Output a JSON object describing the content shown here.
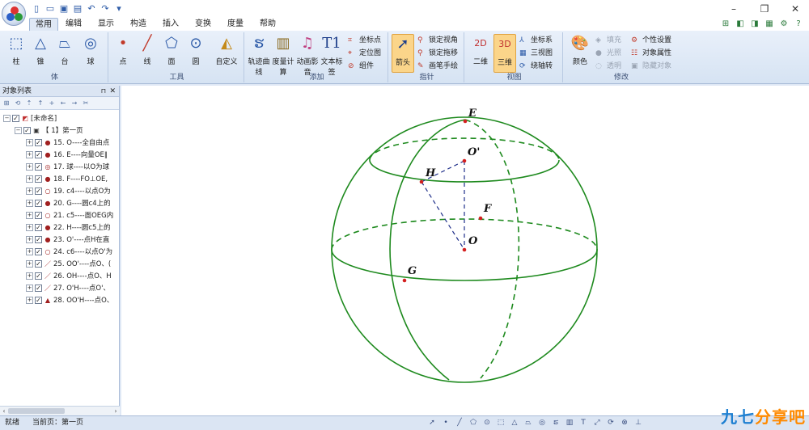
{
  "qat": {
    "icons": [
      "new-file-icon",
      "open-folder-icon",
      "save-icon",
      "print-icon",
      "undo-icon",
      "redo-icon"
    ]
  },
  "window": {
    "minimize": "–",
    "restore": "❐",
    "close": "✕"
  },
  "tabs": [
    {
      "label": "常用"
    },
    {
      "label": "编辑"
    },
    {
      "label": "显示"
    },
    {
      "label": "构造"
    },
    {
      "label": "插入"
    },
    {
      "label": "变换"
    },
    {
      "label": "度量"
    },
    {
      "label": "帮助"
    }
  ],
  "ribbon": {
    "solid": {
      "title": "体",
      "buttons": [
        "柱",
        "锥",
        "台",
        "球"
      ]
    },
    "tools": {
      "title": "工具",
      "buttons": [
        "点",
        "线",
        "面",
        "圆",
        "自定义"
      ]
    },
    "add": {
      "title": "添加",
      "buttons": [
        "轨迹曲线",
        "度量计算",
        "动画影音",
        "文本标签"
      ],
      "small": [
        "坐标点",
        "定位图",
        "组件"
      ]
    },
    "pointer": {
      "title": "指针",
      "buttons": [
        "箭头"
      ],
      "small": [
        "锁定视角",
        "锁定拖移",
        "画笔手绘"
      ]
    },
    "view": {
      "title": "视图",
      "buttons": [
        "二维",
        "三维"
      ],
      "small": [
        "坐标系",
        "三视图",
        "绕轴转"
      ]
    },
    "modify": {
      "title": "修改",
      "buttons": [
        "颜色"
      ],
      "small": [
        "填充",
        "光照",
        "透明",
        "个性设置",
        "对象属性",
        "隐藏对象"
      ]
    }
  },
  "panel": {
    "title": "对象列表",
    "root": "[未命名]",
    "page": "【 1】第一页",
    "items": [
      {
        "label": "15. O----全自由点",
        "glyph": "●"
      },
      {
        "label": "16. E----向量OE∥",
        "glyph": "●"
      },
      {
        "label": "17. 球----以O为球",
        "glyph": "◎"
      },
      {
        "label": "18. F----FO⊥OE,",
        "glyph": "●"
      },
      {
        "label": "19. c4----以点O为",
        "glyph": "○"
      },
      {
        "label": "20. G----圆c4上的",
        "glyph": "●"
      },
      {
        "label": "21. c5----面OEG内",
        "glyph": "○"
      },
      {
        "label": "22. H----圆c5上的",
        "glyph": "●"
      },
      {
        "label": "23. O'----点H在直",
        "glyph": "●"
      },
      {
        "label": "24. c6----以点O'为",
        "glyph": "○"
      },
      {
        "label": "25. OO'----点O、(",
        "glyph": "／"
      },
      {
        "label": "26. OH----点O、H",
        "glyph": "／"
      },
      {
        "label": "27. O'H----点O'、",
        "glyph": "／"
      },
      {
        "label": "28. OO'H----点O、",
        "glyph": "▲"
      }
    ]
  },
  "figure": {
    "labels": {
      "E": "E",
      "O1": "O'",
      "H": "H",
      "F": "F",
      "O": "O",
      "G": "G"
    },
    "colors": {
      "sphere": "#1e8a1e",
      "dashed_lines": "#1f2f8a",
      "points": "#d42020"
    }
  },
  "status": {
    "left": "就绪",
    "page": "当前页：第一页"
  },
  "watermark": {
    "part1": "九七",
    "part2": "分享吧"
  }
}
